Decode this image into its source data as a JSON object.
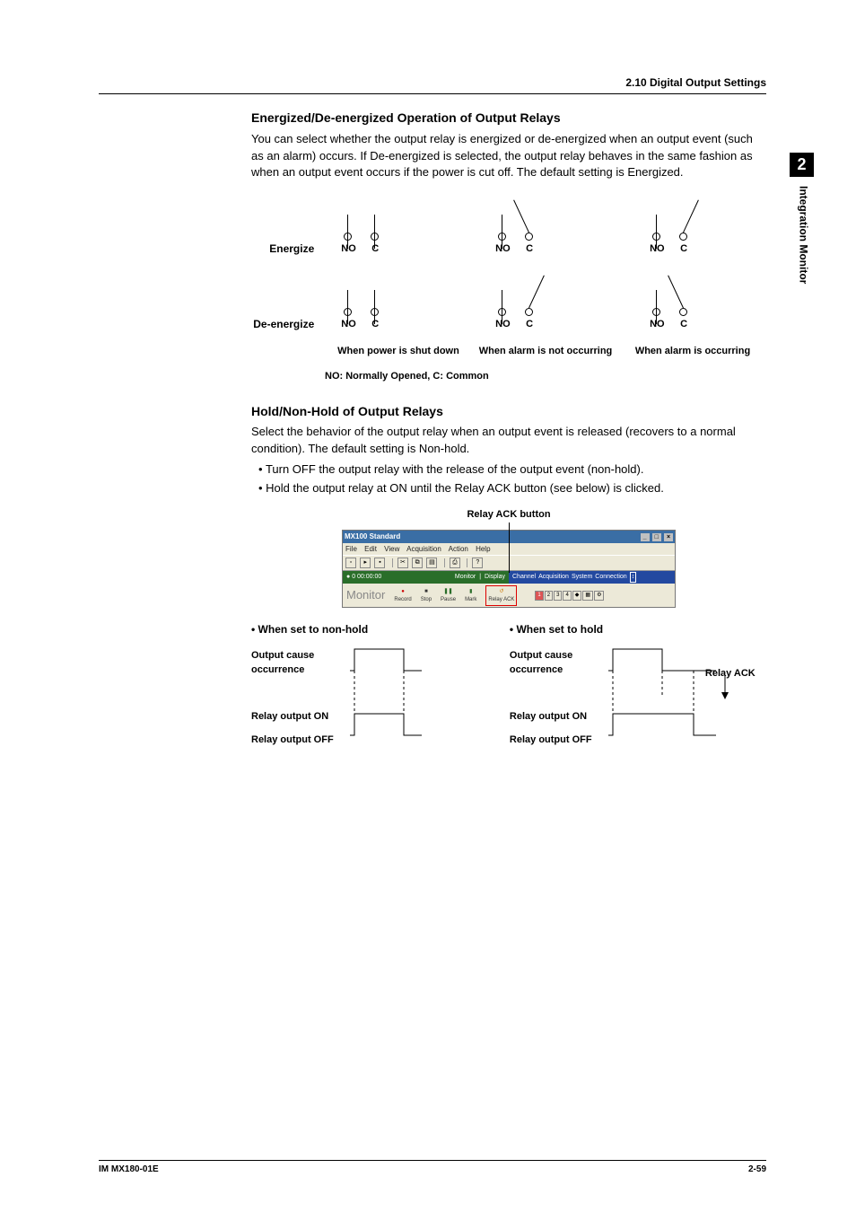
{
  "header": {
    "section": "2.10  Digital Output Settings"
  },
  "side": {
    "chapter": "2",
    "title": "Integration Monitor"
  },
  "s1": {
    "title": "Energized/De-energized Operation of Output Relays",
    "p": "You can select whether the output relay is energized or de-energized when an output event (such as an alarm) occurs. If De-energized is selected, the output relay behaves in the same fashion as when an output event occurs if the power is cut off. The default setting is Energized.",
    "row1": "Energize",
    "row2": "De-energize",
    "no": "NO",
    "c": "C",
    "col1": "When power is shut down",
    "col2": "When alarm is not occurring",
    "col3": "When alarm is occurring",
    "legend": "NO: Normally Opened, C: Common"
  },
  "s2": {
    "title": "Hold/Non-Hold of Output Relays",
    "p": "Select the behavior of the output relay when an output event is released (recovers to a normal condition). The default setting is Non-hold.",
    "b1": "Turn OFF the output relay with the release of the output event (non-hold).",
    "b2": "Hold the output relay at ON until the Relay ACK button (see below) is clicked.",
    "callout": "Relay ACK button"
  },
  "app": {
    "title": "MX100 Standard",
    "menus": [
      "File",
      "Edit",
      "View",
      "Acquisition",
      "Action",
      "Help"
    ],
    "time": "0 00:00:00",
    "ribL": [
      "Monitor",
      "Display"
    ],
    "ribR": [
      "Channel",
      "Acquisition",
      "System",
      "Connection"
    ],
    "mon": "Monitor",
    "btns": [
      "Record",
      "Stop",
      "Pause",
      "Mark",
      "Relay ACK"
    ]
  },
  "timing": {
    "left_title": "• When set to non-hold",
    "right_title": "• When set to hold",
    "r1": "Output cause occurrence",
    "r2": "Relay output ON",
    "r3": "Relay output OFF",
    "ack": "Relay ACK"
  },
  "footer": {
    "doc": "IM MX180-01E",
    "page": "2-59"
  }
}
